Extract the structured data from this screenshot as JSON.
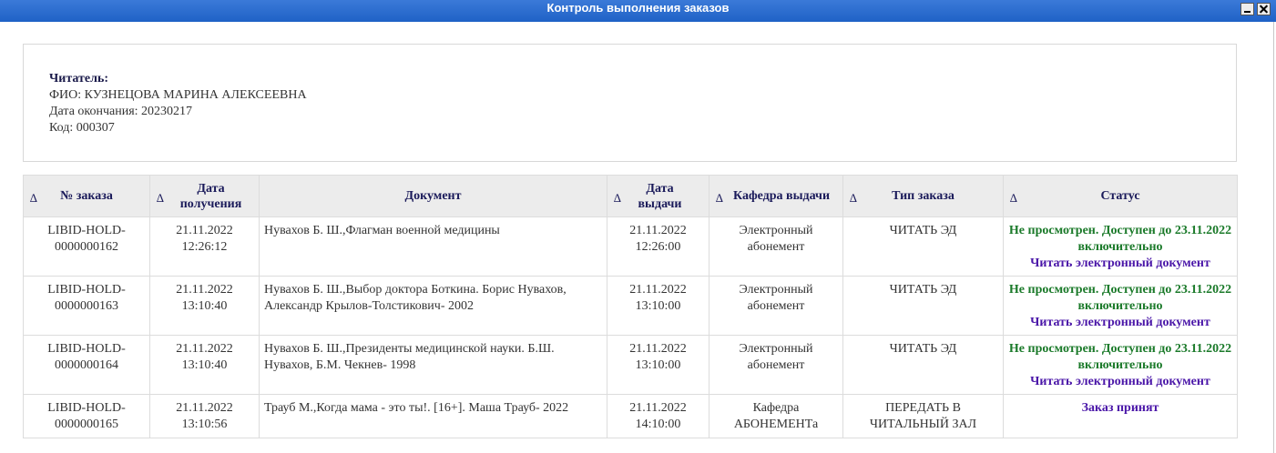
{
  "window": {
    "title": "Контроль выполнения заказов"
  },
  "reader": {
    "label": "Читатель:",
    "fio": "ФИО: КУЗНЕЦОВА МАРИНА АЛЕКСЕЕВНА",
    "end_date": "Дата окончания: 20230217",
    "code": "Код: 000307"
  },
  "table": {
    "sort_glyph": "∆",
    "columns": {
      "order_no": "№ заказа",
      "received": "Дата получения",
      "document": "Документ",
      "issued": "Дата выдачи",
      "dept": "Кафедра выдачи",
      "type": "Тип заказа",
      "status": "Статус"
    },
    "rows": [
      {
        "order_no": "LIBID-HOLD-0000000162",
        "received": "21.11.2022 12:26:12",
        "document": "Нувахов Б. Ш.,Флагман военной медицины",
        "issued": "21.11.2022 12:26:00",
        "dept": "Электронный абонемент",
        "type": "ЧИТАТЬ ЭД",
        "status": "Не просмотрен. Доступен до 23.11.2022 включительно",
        "link": "Читать электронный документ"
      },
      {
        "order_no": "LIBID-HOLD-0000000163",
        "received": "21.11.2022 13:10:40",
        "document": "Нувахов Б. Ш.,Выбор доктора Боткина. Борис Нувахов, Александр Крылов-Толстикович- 2002",
        "issued": "21.11.2022 13:10:00",
        "dept": "Электронный абонемент",
        "type": "ЧИТАТЬ ЭД",
        "status": "Не просмотрен. Доступен до 23.11.2022 включительно",
        "link": "Читать электронный документ"
      },
      {
        "order_no": "LIBID-HOLD-0000000164",
        "received": "21.11.2022 13:10:40",
        "document": "Нувахов Б. Ш.,Президенты медицинской науки. Б.Ш. Нувахов, Б.М. Чекнев- 1998",
        "issued": "21.11.2022 13:10:00",
        "dept": "Электронный абонемент",
        "type": "ЧИТАТЬ ЭД",
        "status": "Не просмотрен. Доступен до 23.11.2022 включительно",
        "link": "Читать электронный документ"
      },
      {
        "order_no": "LIBID-HOLD-0000000165",
        "received": "21.11.2022 13:10:56",
        "document": "Трауб М.,Когда мама - это ты!. [16+]. Маша Трауб- 2022",
        "issued": "21.11.2022 14:10:00",
        "dept": "Кафедра АБОНЕМЕНТа",
        "type": "ПЕРЕДАТЬ В ЧИТАЛЬНЫЙ ЗАЛ",
        "status": "",
        "link": "Заказ принят"
      }
    ]
  },
  "colors": {
    "titlebar": "#1f62c6",
    "header_bg": "#ececec",
    "header_text": "#1a1a5a",
    "status_green": "#1b7a2a",
    "link_purple": "#4a16a8"
  }
}
